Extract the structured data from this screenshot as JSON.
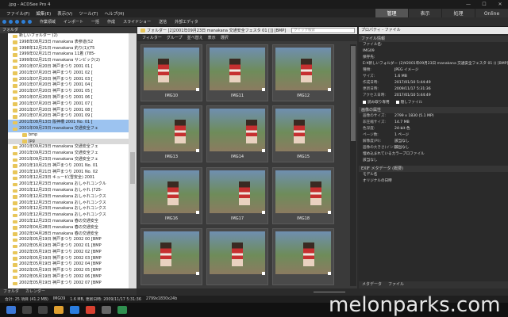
{
  "window": {
    "title": ".jpg - ACDSee Pro 4",
    "min": "—",
    "max": "☐",
    "close": "✕"
  },
  "menu": [
    "ファイル(F)",
    "編集(E)",
    "表示(V)",
    "ツール(T)",
    "ヘルプ(H)"
  ],
  "modes": [
    {
      "label": "管理",
      "active": true
    },
    {
      "label": "表示",
      "active": false
    },
    {
      "label": "処理",
      "active": false
    },
    {
      "label": "Online",
      "active": false
    }
  ],
  "toolbar": {
    "items": [
      "作業領域",
      "インポート",
      "一括",
      "作成",
      "スライドショー",
      "送信",
      "外部エディタ"
    ]
  },
  "folders": {
    "header": "フォルダ",
    "rows": [
      {
        "text": "新しいフォルダー (2)",
        "state": ""
      },
      {
        "text": "1998年08月23日 manakana 表参道(52",
        "state": ""
      },
      {
        "text": "1998年12月21日 manakana 釣り(1)(75",
        "state": ""
      },
      {
        "text": "1999年02月21日 manakana 11着 (785-",
        "state": ""
      },
      {
        "text": "1999年02月21日 manakana サンビック(2)",
        "state": ""
      },
      {
        "text": "2001年07月20日 神戸まつり 2001 01 [",
        "state": ""
      },
      {
        "text": "2001年07月20日 神戸まつり 2001 02 [",
        "state": ""
      },
      {
        "text": "2001年07月20日 神戸まつり 2001 03 [",
        "state": ""
      },
      {
        "text": "2001年07月20日 神戸まつり 2001 04 [",
        "state": ""
      },
      {
        "text": "2001年07月20日 神戸まつり 2001 05 [",
        "state": ""
      },
      {
        "text": "2001年07月20日 神戸まつり 2001 06 [",
        "state": ""
      },
      {
        "text": "2001年07月20日 神戸まつり 2001 07 [",
        "state": ""
      },
      {
        "text": "2001年07月20日 神戸まつり 2001 08 [",
        "state": ""
      },
      {
        "text": "2001年07月20日 神戸まつり 2001 09 [",
        "state": ""
      },
      {
        "text": "2001年08月13日 阪神柵 2001 No. 01 [",
        "state": "sel"
      },
      {
        "text": "2001年09月23日 manakana 交通安全フェ",
        "state": "sel"
      },
      {
        "text": "bmp",
        "state": "sub"
      },
      {
        "text": "jpg",
        "state": "hl"
      },
      {
        "text": "2001年09月23日 manakana 交通安全フェ",
        "state": ""
      },
      {
        "text": "2001年09月23日 manakana 交通安全フェ",
        "state": ""
      },
      {
        "text": "2001年09月23日 manakana 交通安全フェ",
        "state": ""
      },
      {
        "text": "2001年10月21日 神戸まつり 2001 No. 01",
        "state": ""
      },
      {
        "text": "2001年10月21日 神戸まつり 2001 No. 02",
        "state": ""
      },
      {
        "text": "2001年12月23日 キューピ(雪安全) 2001",
        "state": ""
      },
      {
        "text": "2001年12月23日 manakana おしゃれコンクル",
        "state": ""
      },
      {
        "text": "2001年12月23日 manakana おしゃれ (725-",
        "state": ""
      },
      {
        "text": "2001年12月23日 manakana おしゃれコンクス",
        "state": ""
      },
      {
        "text": "2001年12月23日 manakana おしゃれコンクス",
        "state": ""
      },
      {
        "text": "2001年12月23日 manakana おしゃれコンクス",
        "state": ""
      },
      {
        "text": "2001年12月23日 manakana おしゃれコンクス",
        "state": ""
      },
      {
        "text": "2001年12月23日 manakana 春の交通安全",
        "state": ""
      },
      {
        "text": "2002年04月28日 manakana 春の交通安全",
        "state": ""
      },
      {
        "text": "2002年04月28日 manakana 春の交通安全",
        "state": ""
      },
      {
        "text": "2002年05月19日 神戸まつり 2002 00 [BMP",
        "state": ""
      },
      {
        "text": "2002年05月19日 神戸まつり 2002 01 [BMP",
        "state": ""
      },
      {
        "text": "2002年05月19日 神戸まつり 2002 02 [BMP",
        "state": ""
      },
      {
        "text": "2002年05月19日 神戸まつり 2002 03 [BMP",
        "state": ""
      },
      {
        "text": "2002年05月19日 神戸まつり 2002 04 [BMP",
        "state": ""
      },
      {
        "text": "2002年05月19日 神戸まつり 2002 05 [BMP",
        "state": ""
      },
      {
        "text": "2002年05月19日 神戸まつり 2002 06 [BMP",
        "state": ""
      },
      {
        "text": "2002年05月19日 神戸まつり 2002 07 [BMP",
        "state": ""
      }
    ],
    "tabs": [
      "フォルダ",
      "カレンダー"
    ]
  },
  "browser": {
    "path": "フォルダー [2]2001年09月23日 manakana 交通安全フェスタ 01 []] [BMP][jpg]",
    "search_placeholder": "クイック検索",
    "filter": [
      "フィルター",
      "グループ",
      "並べ替え",
      "表示",
      "選択"
    ],
    "thumbs": [
      "IMG10",
      "IMG11",
      "IMG12",
      "IMG13",
      "IMG14",
      "IMG15",
      "IMG16",
      "IMG17",
      "IMG18",
      "",
      "",
      ""
    ]
  },
  "properties": {
    "header": "プロパティ - ファイル",
    "section1": "ファイル情報",
    "filename_label": "ファイル名:",
    "filename": "IMG09",
    "location_label": "保存先:",
    "location": "E:¥新しいフォルダー (2)¥2001年09月23日 manakana 交通安全フェスタ 01 () [BMP][jpg]",
    "kv": [
      {
        "k": "種類:",
        "v": "JPEG イメージ"
      },
      {
        "k": "サイズ:",
        "v": "1.6 MB"
      },
      {
        "k": "作成日時:",
        "v": "2017/01/10 5:44:49"
      },
      {
        "k": "更新日時:",
        "v": "2009/11/17 5:31:36"
      },
      {
        "k": "アクセス日時:",
        "v": "2017/01/10 5:44:49"
      }
    ],
    "checks": [
      "読み取り専用",
      "隠しファイル"
    ],
    "section2": "画像の属性",
    "img": [
      {
        "k": "画像のサイズ:",
        "v": "2799 x 1830 (5.1 MP)"
      },
      {
        "k": "非圧縮サイズ:",
        "v": "14.7 MB"
      },
      {
        "k": "色深度:",
        "v": "24-bit 色"
      },
      {
        "k": "ページ数:",
        "v": "1 ページ"
      },
      {
        "k": "解像度(PI):",
        "v": "該当なし"
      },
      {
        "k": "画像の大きさ(インチ):",
        "v": "該当なし"
      }
    ],
    "embedded": "埋め込まれているカラープロファイル",
    "embedded_val": "該当なし",
    "section3": "EXIF メタデータ (概要)",
    "exif1": "モデル名",
    "exif2": "オリジナルの日時",
    "tabs": [
      "メタデータ",
      "ファイル"
    ]
  },
  "status": {
    "items": [
      "合計: 25 項目 (41.2 MB)",
      "IMG09",
      "1.6 MB, 更新日時: 2009/11/17 5:31:36",
      "2799x1830x24b"
    ]
  },
  "watermark": "melonparks.com"
}
